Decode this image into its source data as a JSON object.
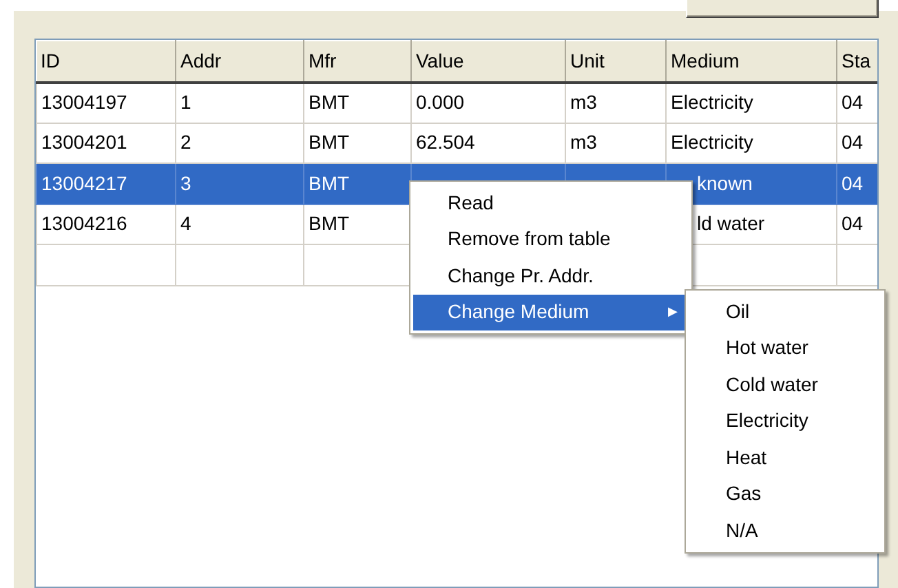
{
  "table": {
    "columns": [
      {
        "label": "ID"
      },
      {
        "label": "Addr"
      },
      {
        "label": "Mfr"
      },
      {
        "label": "Value"
      },
      {
        "label": "Unit"
      },
      {
        "label": "Medium"
      },
      {
        "label": "Sta"
      }
    ],
    "rows": [
      {
        "selected": false,
        "cells": [
          {
            "text": "13004197"
          },
          {
            "text": "1"
          },
          {
            "text": "BMT"
          },
          {
            "text": "0.000"
          },
          {
            "text": "m3"
          },
          {
            "text": "Electricity"
          },
          {
            "text": "04"
          }
        ]
      },
      {
        "selected": false,
        "cells": [
          {
            "text": "13004201"
          },
          {
            "text": "2"
          },
          {
            "text": "BMT"
          },
          {
            "text": "62.504"
          },
          {
            "text": "m3"
          },
          {
            "text": "Electricity"
          },
          {
            "text": "04"
          }
        ]
      },
      {
        "selected": true,
        "cells": [
          {
            "text": "13004217"
          },
          {
            "text": "3"
          },
          {
            "text": "BMT"
          },
          {},
          {},
          {
            "text": "known",
            "partial": true
          },
          {
            "text": "04"
          }
        ]
      },
      {
        "selected": false,
        "cells": [
          {
            "text": "13004216"
          },
          {
            "text": "4"
          },
          {
            "text": "BMT"
          },
          {},
          {},
          {
            "text": "ld water",
            "partial": true
          },
          {
            "text": "04"
          }
        ]
      }
    ]
  },
  "context_menu": {
    "items": [
      {
        "label": "Read",
        "selected": false
      },
      {
        "label": "Remove from table",
        "selected": false
      },
      {
        "label": "Change Pr. Addr.",
        "selected": false
      },
      {
        "label": "Change Medium",
        "selected": true,
        "submenu_arrow": "▶"
      }
    ]
  },
  "submenu": {
    "items": [
      {
        "label": "Oil"
      },
      {
        "label": "Hot water"
      },
      {
        "label": "Cold water"
      },
      {
        "label": "Electricity"
      },
      {
        "label": "Heat"
      },
      {
        "label": "Gas"
      },
      {
        "label": "N/A"
      }
    ]
  }
}
